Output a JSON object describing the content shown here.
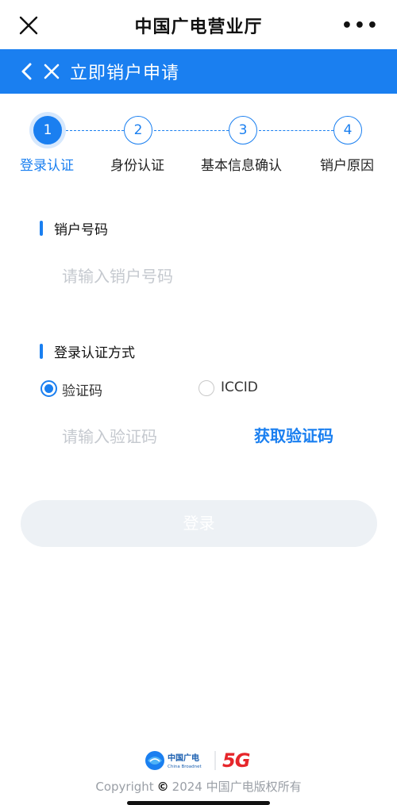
{
  "topbar": {
    "title": "中国广电营业厅"
  },
  "header": {
    "title": "立即销户申请"
  },
  "steps": [
    {
      "number": "1",
      "label": "登录认证",
      "active": true
    },
    {
      "number": "2",
      "label": "身份认证",
      "active": false
    },
    {
      "number": "3",
      "label": "基本信息确认",
      "active": false
    },
    {
      "number": "4",
      "label": "销户原因",
      "active": false
    }
  ],
  "form": {
    "account_title": "销户号码",
    "account_placeholder": "请输入销户号码",
    "method_title": "登录认证方式",
    "method_options": [
      {
        "label": "验证码",
        "checked": true
      },
      {
        "label": "ICCID",
        "checked": false
      }
    ],
    "code_placeholder": "请输入验证码",
    "get_code_label": "获取验证码",
    "login_label": "登录"
  },
  "footer": {
    "brand_cn": "中国广电",
    "brand_en": "China Broadnet",
    "fiveg": "5G",
    "copyright_prefix": "Copyright",
    "copyright_text": "2024 中国广电版权所有"
  },
  "colors": {
    "accent": "#1a7ff0",
    "fiveg_red": "#e6262b",
    "fiveg_orange": "#f5a01a"
  }
}
